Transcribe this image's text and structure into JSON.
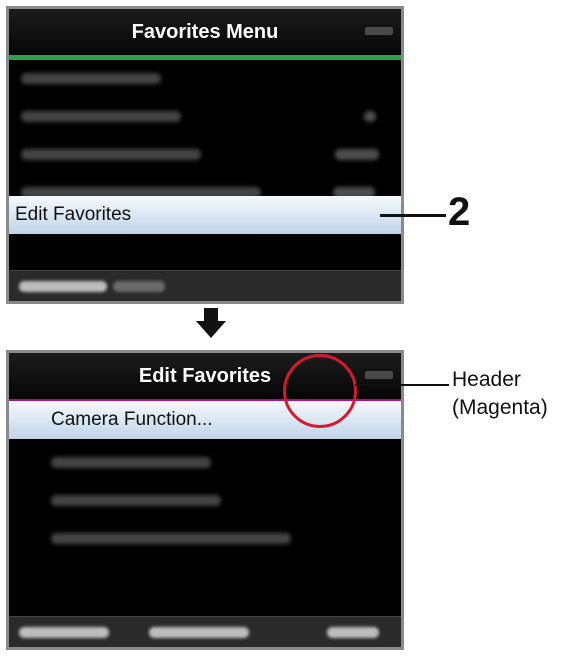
{
  "top_screen": {
    "title": "Favorites Menu",
    "selected_item": "Edit Favorites"
  },
  "callout": {
    "step_number": "2"
  },
  "bottom_screen": {
    "title": "Edit Favorites",
    "selected_item": "Camera Function..."
  },
  "annotation": {
    "line1": "Header",
    "line2": "(Magenta)"
  },
  "colors": {
    "header_line_top": "#2da050",
    "header_line_bottom": "#a8128a",
    "highlight_circle": "#d5192f",
    "selection_bg": "#c8d8ea"
  }
}
